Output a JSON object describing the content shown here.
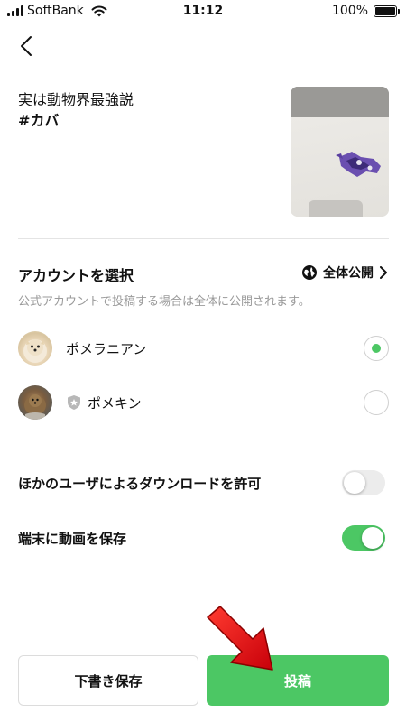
{
  "status_bar": {
    "carrier": "SoftBank",
    "time": "11:12",
    "battery": "100%",
    "battery_level": 1.0
  },
  "post": {
    "caption_line1": "実は動物界最強説",
    "caption_line2": "#カバ"
  },
  "account_section": {
    "title": "アカウントを選択",
    "visibility": "全体公開",
    "note": "公式アカウントで投稿する場合は全体に公開されます。",
    "accounts": [
      {
        "name": "ポメラニアン",
        "selected": true
      },
      {
        "name": "ポメキン",
        "selected": false
      }
    ]
  },
  "settings": {
    "allow_download_label": "ほかのユーザによるダウンロードを許可",
    "allow_download_on": false,
    "save_video_label": "端末に動画を保存",
    "save_video_on": true
  },
  "actions": {
    "draft_label": "下書き保存",
    "post_label": "投稿"
  },
  "colors": {
    "accent": "#4cc764",
    "annotation_arrow": "#e8141c"
  }
}
